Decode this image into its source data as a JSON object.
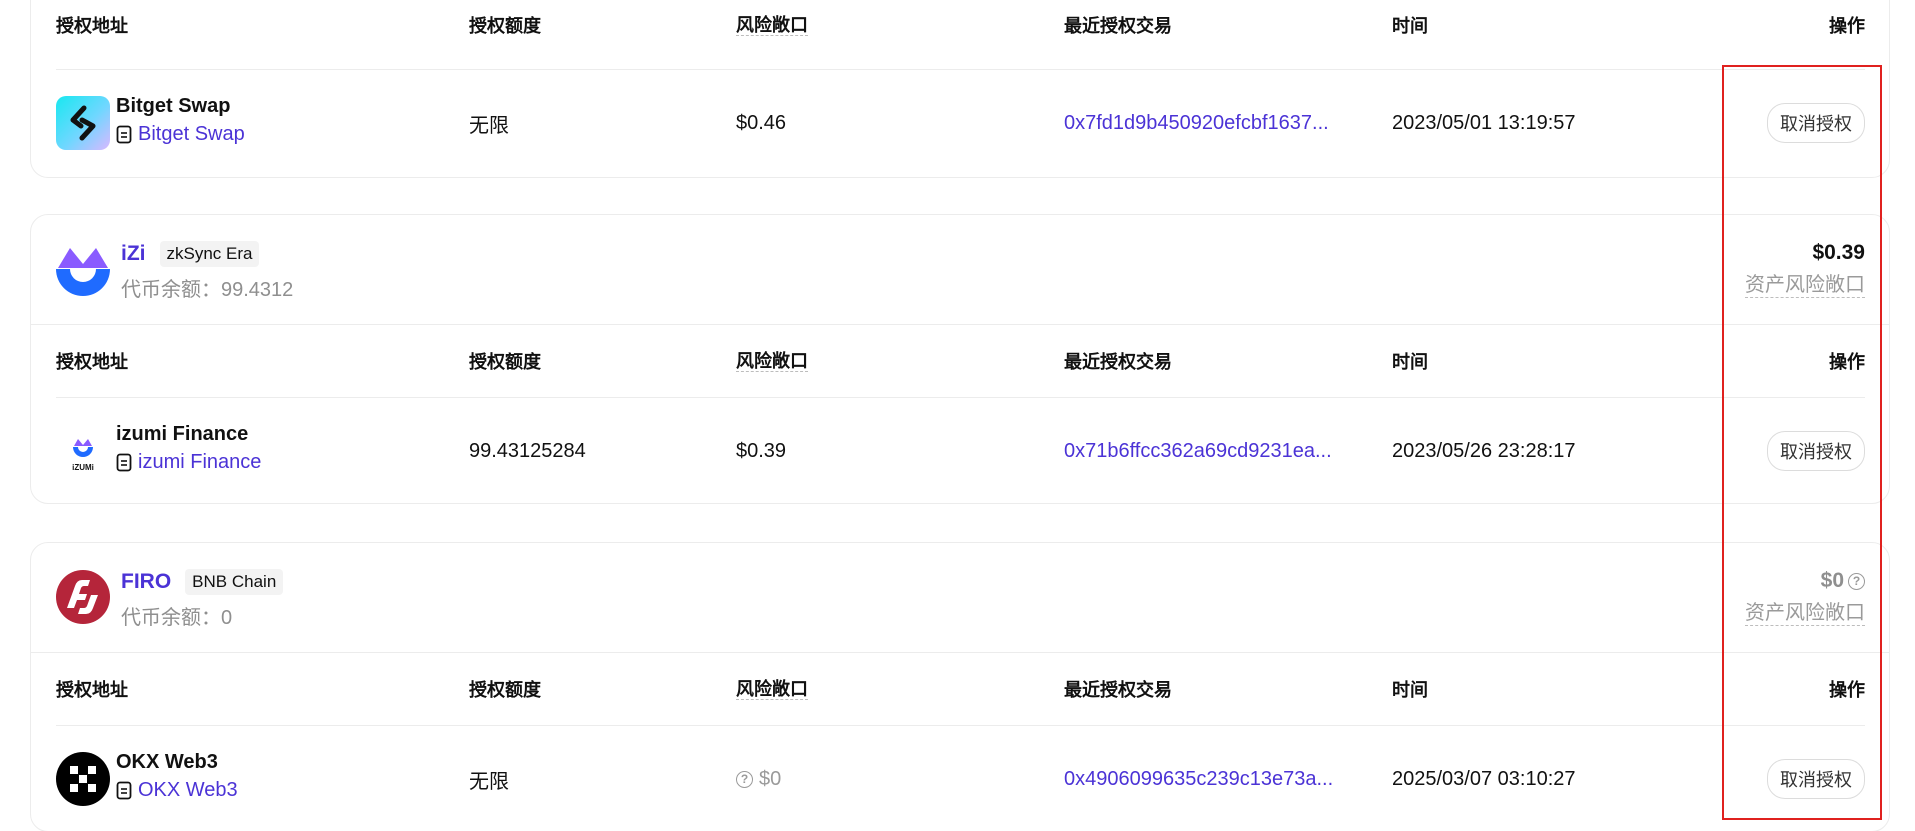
{
  "columns": {
    "spender": "授权地址",
    "amount": "授权额度",
    "risk": "风险敞口",
    "tx": "最近授权交易",
    "time": "时间",
    "action": "操作"
  },
  "exposure_label": "资产风险敞口",
  "revoke_label": "取消授权",
  "colors": {
    "link": "#4b33d6",
    "highlight": "#e0211f",
    "muted": "#9a9a9a"
  },
  "cards": [
    {
      "token": null,
      "row": {
        "spender_name": "Bitget Swap",
        "spender_link": "Bitget Swap",
        "spender_icon": "bitget-swap-logo",
        "amount": "无限",
        "risk": "$0.46",
        "tx": "0x7fd1d9b450920efcbf1637...",
        "time": "2023/05/01 13:19:57"
      }
    },
    {
      "token": {
        "name": "iZi",
        "chain": "zkSync Era",
        "balance": "代币余额：99.4312",
        "exposure": "$0.39",
        "icon": "izi-logo"
      },
      "row": {
        "spender_name": "izumi Finance",
        "spender_link": "izumi Finance",
        "spender_icon": "izumi-finance-logo",
        "amount": "99.43125284",
        "risk": "$0.39",
        "tx": "0x71b6ffcc362a69cd9231ea...",
        "time": "2023/05/26 23:28:17"
      }
    },
    {
      "token": {
        "name": "FIRO",
        "chain": "BNB Chain",
        "balance": "代币余额：0",
        "exposure": "$0",
        "icon": "firo-logo"
      },
      "row": {
        "spender_name": "OKX Web3",
        "spender_link": "OKX Web3",
        "spender_icon": "okx-web3-logo",
        "amount": "无限",
        "risk": "$0",
        "tx": "0x4906099635c239c13e73a...",
        "time": "2025/03/07 03:10:27"
      }
    }
  ]
}
